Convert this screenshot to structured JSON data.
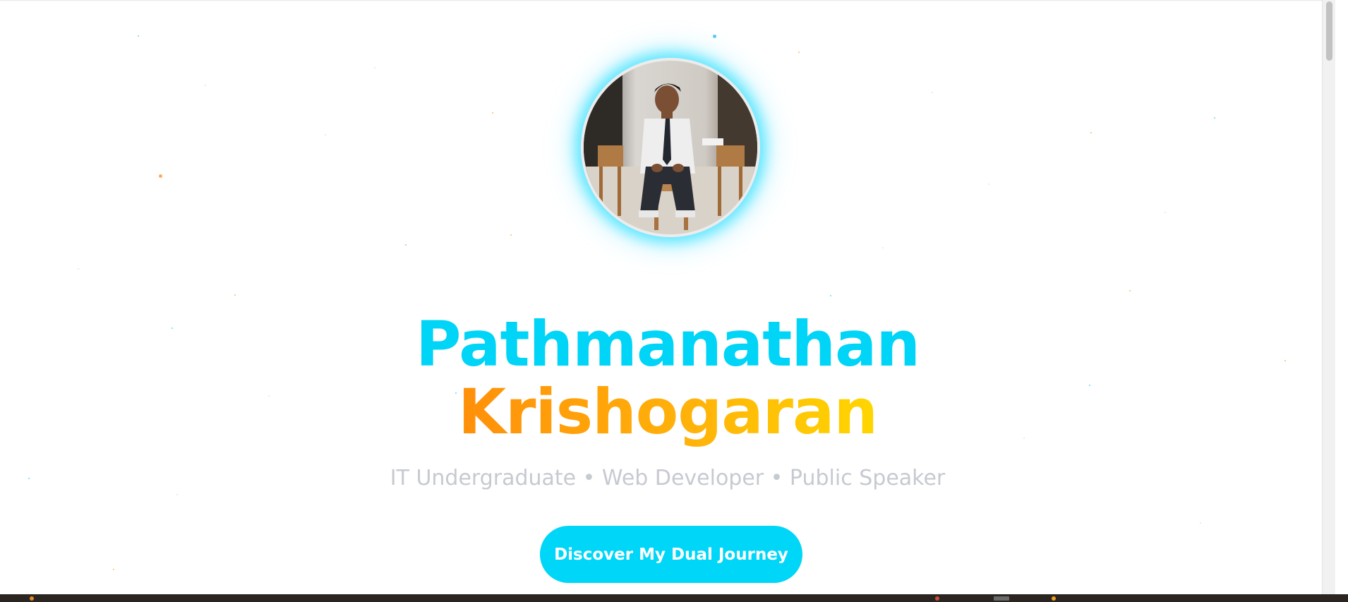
{
  "hero": {
    "first_name": "Pathmanathan",
    "last_name": "Krishogaran",
    "tagline": "IT Undergraduate • Web Developer • Public Speaker",
    "cta_label": "Discover My Dual Journey",
    "profile_photo_icon": "profile-photo"
  },
  "colors": {
    "accent_cyan": "#00d4f7",
    "accent_orange": "#ff8f0a",
    "accent_yellow": "#ffd600",
    "tagline_gray": "#c6cad1",
    "button_bg": "#00d6f7"
  }
}
